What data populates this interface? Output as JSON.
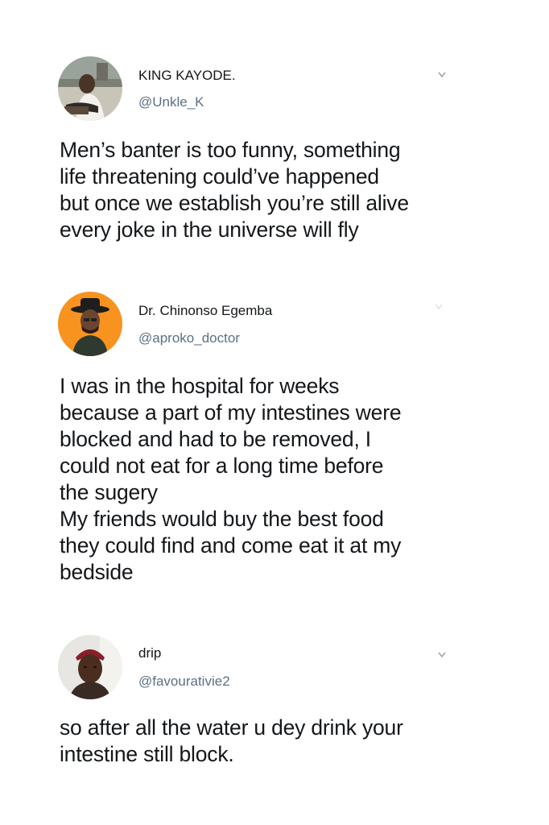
{
  "tweets": [
    {
      "display_name": "KING KAYODE.",
      "handle": "@Unkle_K",
      "text": "Men’s banter is too funny, something\nlife threatening could’ve happened\nbut once we establish you’re still alive\nevery joke in the universe will fly",
      "avatar": "profile-photo",
      "menu_icon": "chevron-down-icon"
    },
    {
      "display_name": "Dr. Chinonso Egemba",
      "handle": "@aproko_doctor",
      "text": "I was in the hospital for weeks\nbecause a part of my intestines were\nblocked and had to be removed, I\ncould not eat for a long time before\nthe sugery\nMy friends would buy the best food\nthey could find and come eat it at my\nbedside",
      "avatar": "profile-photo",
      "avatar_background": "#f7931e",
      "menu_icon": "chevron-down-icon"
    },
    {
      "display_name": "drip",
      "handle": "@favourativie2",
      "text": "so after all the water u dey drink your\nintestine still block.",
      "avatar": "profile-photo",
      "menu_icon": "chevron-down-icon"
    }
  ],
  "colors": {
    "text": "#14171a",
    "secondary_text": "#5b7083",
    "background": "#ffffff"
  }
}
